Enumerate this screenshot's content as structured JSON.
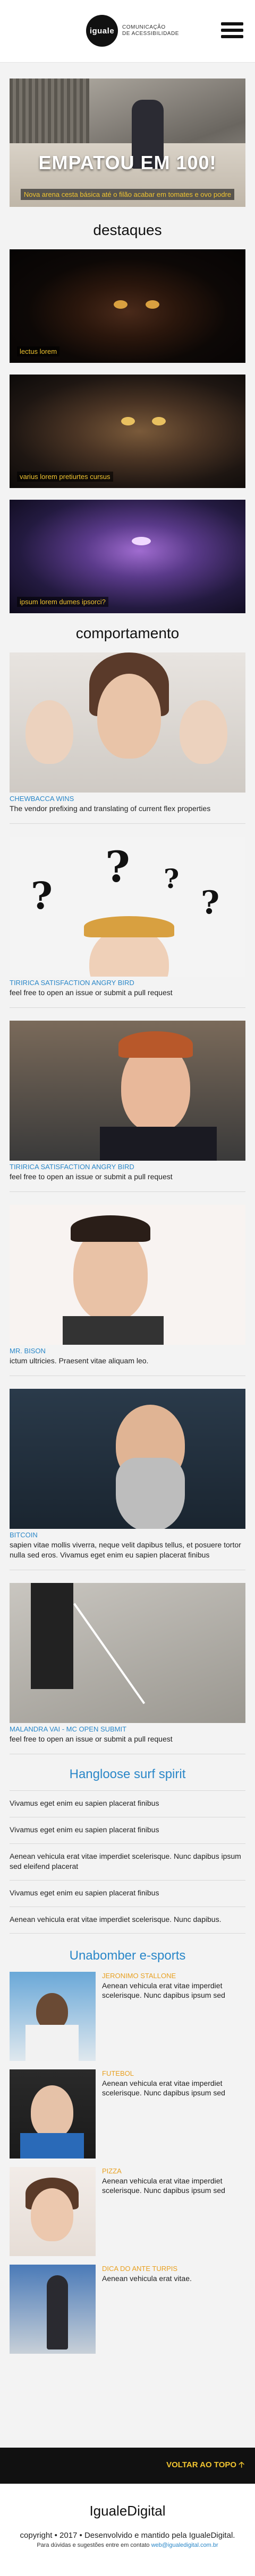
{
  "header": {
    "logo_text": "iguale",
    "logo_sub_line1": "COMUNICAÇÃO",
    "logo_sub_line2": "DE ACESSIBILIDADE"
  },
  "hero": {
    "title": "EMPATOU EM 100!",
    "caption": "Nova arena cesta básica até o filão acabar em tomates e ovo podre"
  },
  "destaques": {
    "heading": "destaques",
    "items": [
      {
        "caption": "lectus lorem"
      },
      {
        "caption": "varius lorem pretiurtes cursus"
      },
      {
        "caption": "ipsum lorem dumes ipsorci?"
      }
    ]
  },
  "comportamento": {
    "heading": "comportamento",
    "items": [
      {
        "tag": "CHEWBACCA WINS",
        "text": "The vendor prefixing and translating of current flex properties"
      },
      {
        "tag": "TIRIRICA SATISFACTION ANGRY BIRD",
        "text": "feel free to open an issue or submit a pull request"
      },
      {
        "tag": "TIRIRICA SATISFACTION ANGRY BIRD",
        "text": "feel free to open an issue or submit a pull request"
      },
      {
        "tag": "MR. BISON",
        "text": "ictum ultricies. Praesent vitae aliquam leo."
      },
      {
        "tag": "BITCOIN",
        "text": "sapien vitae mollis viverra, neque velit dapibus tellus, et posuere tortor nulla sed eros. Vivamus eget enim eu sapien placerat finibus"
      },
      {
        "tag": "MALANDRA VAI - MC OPEN SUBMIT",
        "text": "feel free to open an issue or submit a pull request"
      }
    ]
  },
  "surf": {
    "heading": "Hangloose surf spirit",
    "items": [
      "Vivamus eget enim eu sapien placerat finibus",
      "Vivamus eget enim eu sapien placerat finibus",
      "Aenean vehicula erat vitae imperdiet scelerisque. Nunc dapibus ipsum sed eleifend placerat",
      "Vivamus eget enim eu sapien placerat finibus",
      "Aenean vehicula erat vitae imperdiet scelerisque. Nunc dapibus."
    ]
  },
  "esports": {
    "heading": "Unabomber e-sports",
    "items": [
      {
        "tag": "JERONIMO STALLONE",
        "text": "Aenean vehicula erat vitae imperdiet scelerisque. Nunc dapibus ipsum sed"
      },
      {
        "tag": "FUTEBOL",
        "text": "Aenean vehicula erat vitae imperdiet scelerisque. Nunc dapibus ipsum sed"
      },
      {
        "tag": "PIZZA",
        "text": "Aenean vehicula erat vitae imperdiet scelerisque. Nunc dapibus ipsum sed"
      },
      {
        "tag": "DICA DO ANTE TURPIS",
        "text": "Aenean vehicula erat vitae."
      }
    ]
  },
  "footer": {
    "back_to_top": "VOLTAR AO TOPO",
    "brand": "IgualeDigital",
    "copyright": "copyright • 2017 • Desenvolvido e mantido pela IgualeDigital.",
    "contact_prefix": "Para dúvidas e sugestões entre em contato ",
    "contact_link": "web@igualedigital.com.br"
  },
  "colors": {
    "accent_blue": "#2a87c8",
    "accent_yellow": "#f0c430",
    "accent_orange": "#e8a020"
  }
}
